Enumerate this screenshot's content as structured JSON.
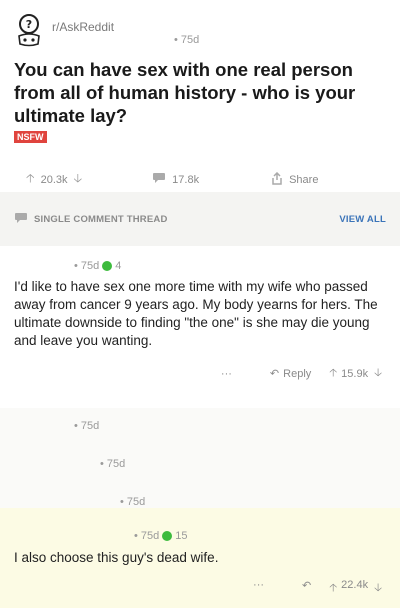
{
  "post": {
    "subreddit": "r/AskReddit",
    "age": "• 75d",
    "title": "You can have sex with one real person from all of human history - who is your ultimate lay?",
    "tag": "NSFW",
    "upvotes": "20.3k",
    "comments": "17.8k",
    "share": "Share"
  },
  "thread": {
    "label": "SINGLE COMMENT THREAD",
    "view_all": "VIEW ALL"
  },
  "comment1": {
    "age": "• 75d",
    "awards": "4",
    "text": "I'd like to have sex one more time with my wife who passed away from cancer 9 years ago.  My body yearns for hers.  The ultimate downside to finding \"the one\" is she may die young and leave you wanting.",
    "more": "···",
    "reply": "Reply",
    "score": "15.9k"
  },
  "nested": {
    "a": "• 75d",
    "b": "• 75d",
    "c": "• 75d"
  },
  "comment2": {
    "age": "• 75d",
    "awards": "15",
    "text": "I also choose this guy's dead wife.",
    "more": "···",
    "score": "22.4k"
  },
  "colors": {
    "accent": "#3b74b9",
    "nsfw": "#e0443e",
    "award": "#3dbb3d",
    "highlight": "#fcfbe4"
  }
}
